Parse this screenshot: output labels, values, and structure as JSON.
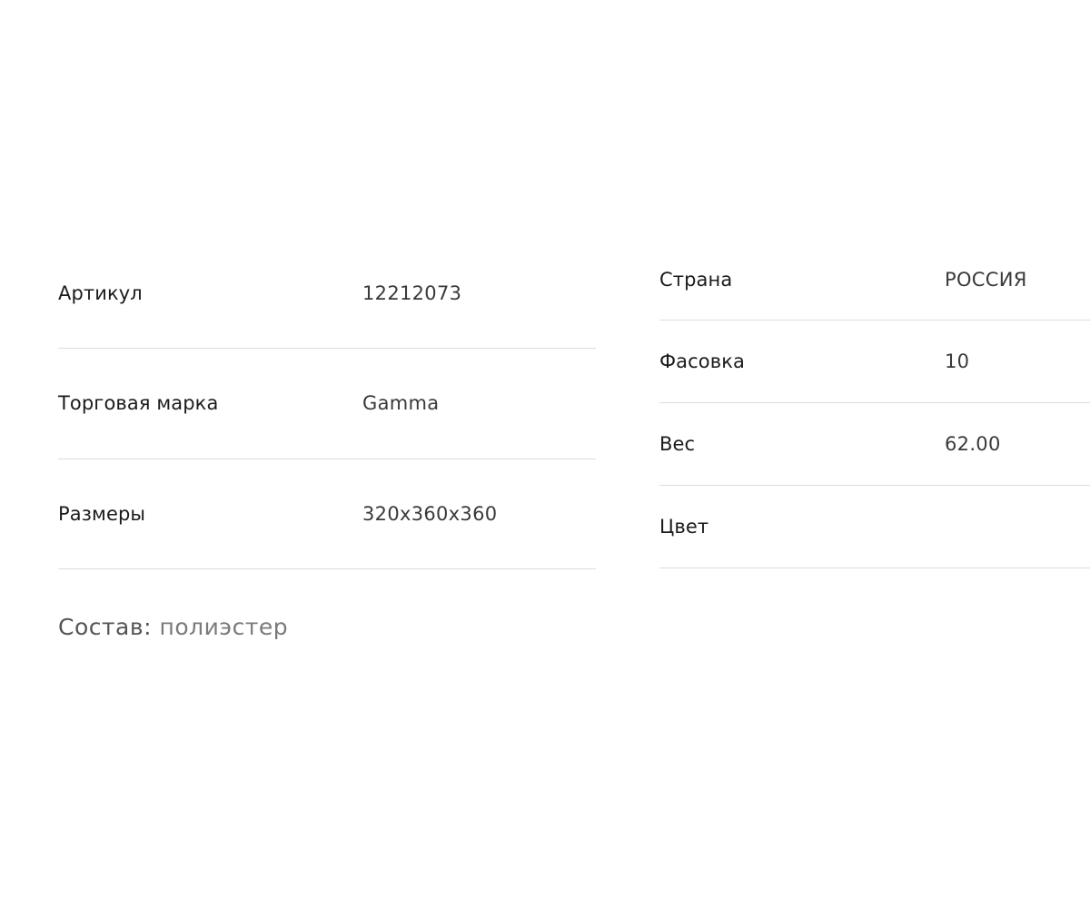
{
  "specs_left": [
    {
      "label": "Артикул",
      "value": "12212073"
    },
    {
      "label": "Торговая марка",
      "value": "Gamma"
    },
    {
      "label": "Размеры",
      "value": "320x360x360"
    }
  ],
  "specs_right": [
    {
      "label": "Страна",
      "value": "РОССИЯ"
    },
    {
      "label": "Фасовка",
      "value": "10"
    },
    {
      "label": "Вес",
      "value": "62.00"
    },
    {
      "label": "Цвет",
      "value": ""
    }
  ],
  "composition": {
    "label": "Состав:",
    "value": "полиэстер"
  }
}
